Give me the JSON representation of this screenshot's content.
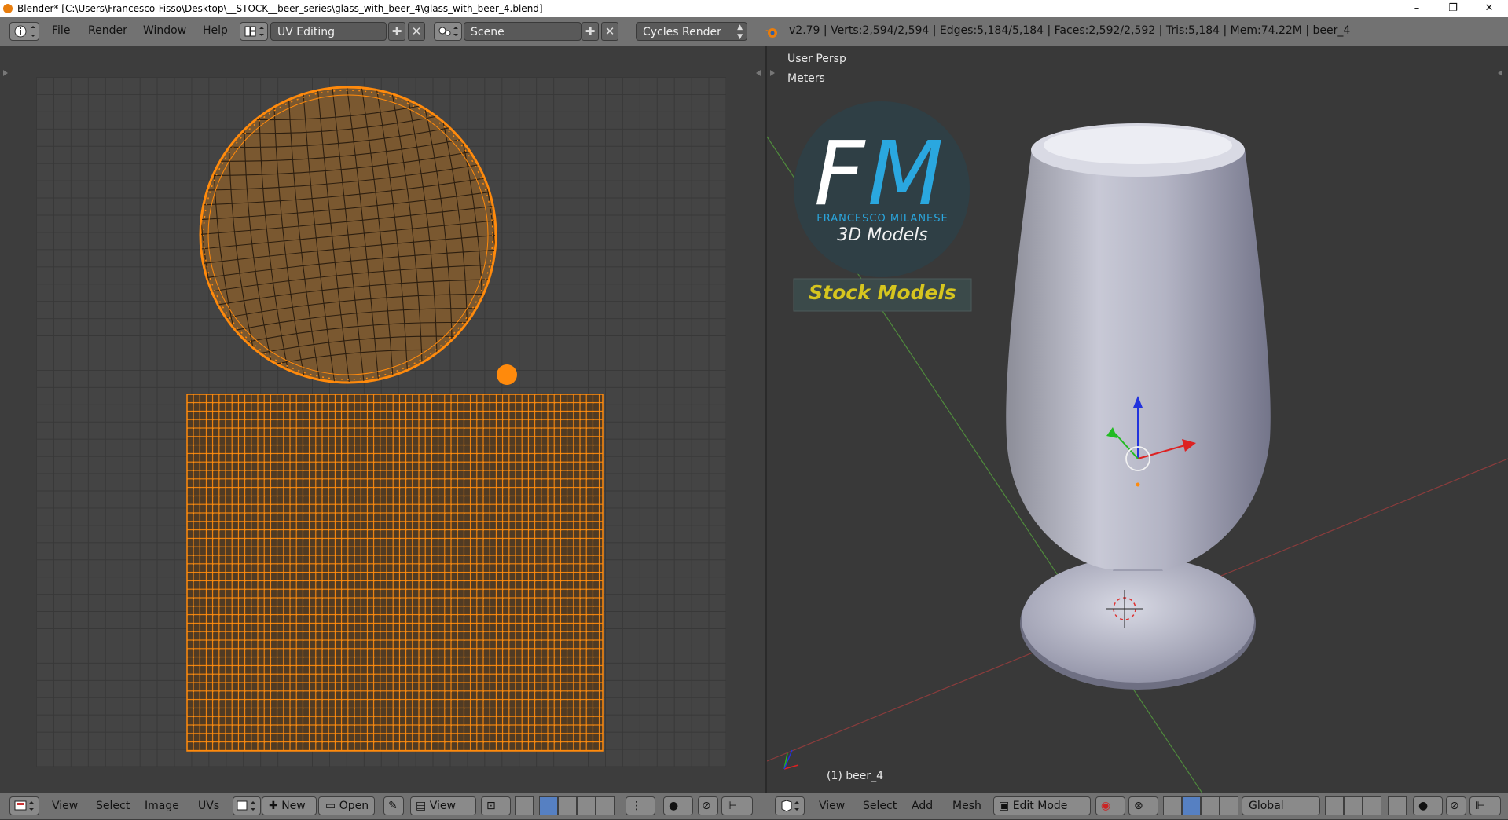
{
  "window": {
    "title": "Blender* [C:\\Users\\Francesco-Fisso\\Desktop\\__STOCK__beer_series\\glass_with_beer_4\\glass_with_beer_4.blend]",
    "minimize": "–",
    "maximize": "❐",
    "close": "✕"
  },
  "info_header": {
    "menus": [
      "File",
      "Render",
      "Window",
      "Help"
    ],
    "screen_layout": "UV Editing",
    "scene": "Scene",
    "render_engine": "Cycles Render",
    "stats": "v2.79 | Verts:2,594/2,594 | Edges:5,184/5,184 | Faces:2,592/2,592 | Tris:5,184 | Mem:74.22M | beer_4"
  },
  "uv_editor": {
    "menus": [
      "View",
      "Select",
      "Image",
      "UVs"
    ],
    "new_label": "New",
    "open_label": "Open",
    "view_label": "View"
  },
  "viewport": {
    "view_name": "User Persp",
    "units": "Meters",
    "object_label": "(1) beer_4",
    "menus": [
      "View",
      "Select",
      "Add",
      "Mesh"
    ],
    "mode": "Edit Mode",
    "orientation": "Global"
  },
  "logo": {
    "letters_f": "F",
    "letters_m": "M",
    "name": "FRANCESCO MILANESE",
    "subtitle": "3D Models",
    "banner": "Stock Models"
  },
  "colors": {
    "accent_orange": "#e8870f",
    "logo_blue": "#2aa7df",
    "banner_yellow": "#d6c51f",
    "header_gray": "#727272",
    "edit_mode_blue": "#5680c2"
  }
}
